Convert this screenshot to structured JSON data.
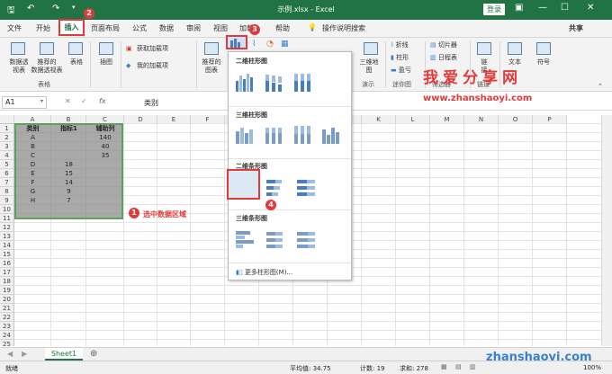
{
  "titlebar": {
    "title": "示例.xlsx - Excel",
    "login": "登录"
  },
  "tabs": [
    "文件",
    "开始",
    "插入",
    "页面布局",
    "公式",
    "数据",
    "审阅",
    "视图",
    "加载",
    "帮助",
    "操作说明搜索"
  ],
  "share": "共享",
  "ribbon": {
    "b1": "数据透\n视表",
    "b2": "推荐的\n数据透视表",
    "b3": "表格",
    "b4": "插图",
    "addin_get": "获取加载项",
    "addin_mine": "我的加载项",
    "b5": "推荐的\n图表",
    "b6": "三维地\n图",
    "b7a": "折线",
    "b7b": "柱形",
    "b7c": "盈亏",
    "b8a": "切片器",
    "b8b": "日程表",
    "b9": "链\n接",
    "b10": "文本",
    "b11": "符号",
    "g1": "表格",
    "g2": "演示",
    "g3": "迷你图",
    "g4": "筛选器",
    "g5": "链接"
  },
  "formula_bar": {
    "name_box": "A1",
    "fx": "fx",
    "value": "类别"
  },
  "columns": [
    "A",
    "B",
    "C",
    "D",
    "E",
    "F",
    "G",
    "H",
    "I",
    "J",
    "K",
    "L",
    "M",
    "N",
    "O",
    "P"
  ],
  "rows": [
    "1",
    "2",
    "3",
    "4",
    "5",
    "6",
    "7",
    "8",
    "9",
    "10",
    "11",
    "12",
    "13",
    "14",
    "15",
    "16",
    "17",
    "18",
    "19",
    "20",
    "21",
    "22",
    "23",
    "24",
    "25"
  ],
  "table": {
    "headers": [
      "类别",
      "指标1",
      "辅助列"
    ],
    "rows": [
      [
        "A",
        "",
        "140"
      ],
      [
        "B",
        "",
        "40"
      ],
      [
        "C",
        "",
        "35"
      ],
      [
        "D",
        "18",
        ""
      ],
      [
        "E",
        "15",
        ""
      ],
      [
        "F",
        "14",
        ""
      ],
      [
        "G",
        "9",
        ""
      ],
      [
        "H",
        "7",
        ""
      ]
    ]
  },
  "dropdown": {
    "h1": "二维柱形图",
    "h2": "三维柱形图",
    "h3": "二维条形图",
    "h4": "三维条形图",
    "more": "更多柱形图(M)..."
  },
  "annotation": "选中数据区域",
  "badges": [
    "1",
    "2",
    "3",
    "4"
  ],
  "watermark": {
    "cn": "我爱分享网",
    "url1": "www.zhanshaoyi.com",
    "url2": "zhanshaoyi.com"
  },
  "sheet_tab": "Sheet1",
  "status": {
    "ready": "就绪",
    "avg": "平均值: 34.75",
    "count": "计数: 19",
    "sum": "求和: 278",
    "zoom": "100%"
  },
  "colors": {
    "excel_green": "#217346",
    "annotation_red": "#e03a3a"
  }
}
